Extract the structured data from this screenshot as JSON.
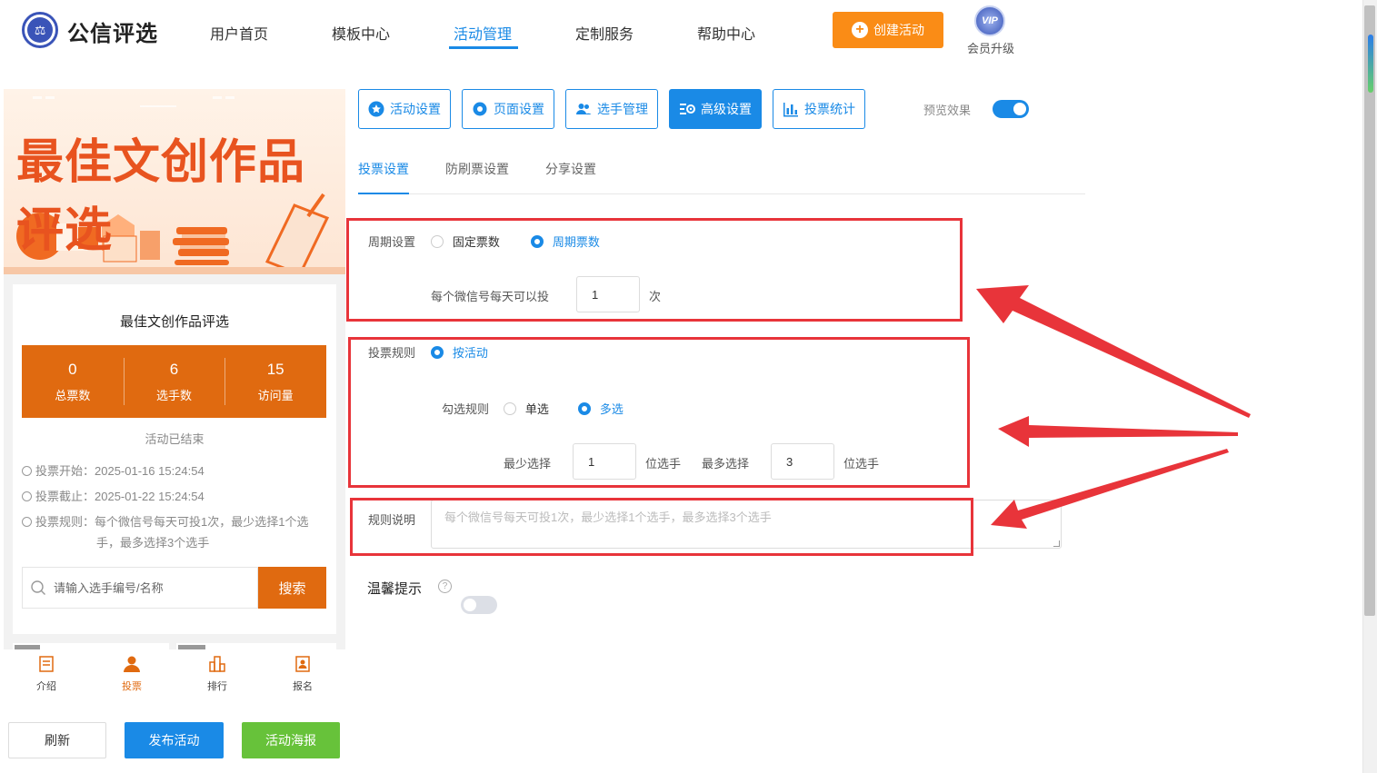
{
  "header": {
    "brand": "公信评选",
    "nav": [
      "用户首页",
      "模板中心",
      "活动管理",
      "定制服务",
      "帮助中心"
    ],
    "active_nav": "活动管理",
    "create_button": "创建活动",
    "vip_badge": "VIP",
    "vip_label": "会员升级"
  },
  "preview": {
    "banner_title": "最佳文创作品评选",
    "card_title": "最佳文创作品评选",
    "stats": [
      {
        "value": "0",
        "label": "总票数"
      },
      {
        "value": "6",
        "label": "选手数"
      },
      {
        "value": "15",
        "label": "访问量"
      }
    ],
    "status": "活动已结束",
    "vote_start": "投票开始：2025-01-16 15:24:54",
    "vote_end": "投票截止：2025-01-22 15:24:54",
    "vote_rule_line1": "投票规则：每个微信号每天可投1次，最少选择1个选",
    "vote_rule_line2": "手，最多选择3个选手",
    "search_placeholder": "请输入选手编号/名称",
    "search_button": "搜索",
    "tabbar": [
      "介绍",
      "投票",
      "排行",
      "报名"
    ],
    "active_tab": "投票"
  },
  "bottom_buttons": {
    "refresh": "刷新",
    "publish": "发布活动",
    "poster": "活动海报"
  },
  "toolbar": {
    "buttons": [
      "活动设置",
      "页面设置",
      "选手管理",
      "高级设置",
      "投票统计"
    ],
    "active": "高级设置",
    "preview_label": "预览效果",
    "preview_on": true
  },
  "subtabs": [
    "投票设置",
    "防刷票设置",
    "分享设置"
  ],
  "active_subtab": "投票设置",
  "form": {
    "period_label": "周期设置",
    "period_options": [
      "固定票数",
      "周期票数"
    ],
    "period_selected": "周期票数",
    "daily_label": "每个微信号每天可以投",
    "daily_value": "1",
    "daily_unit": "次",
    "rule_label": "投票规则",
    "rule_option": "按活动",
    "check_label": "勾选规则",
    "check_options": [
      "单选",
      "多选"
    ],
    "check_selected": "多选",
    "min_label": "最少选择",
    "min_value": "1",
    "min_unit": "位选手",
    "max_label": "最多选择",
    "max_value": "3",
    "max_unit": "位选手",
    "desc_label": "规则说明",
    "desc_placeholder": "每个微信号每天可投1次，最少选择1个选手，最多选择3个选手",
    "tip_label": "温馨提示",
    "tip_on": false
  },
  "colors": {
    "primary": "#1a8ae6",
    "orange": "#fa8c16",
    "brand_orange": "#e06a10",
    "highlight_red": "#e8343a",
    "green": "#67c23a"
  }
}
